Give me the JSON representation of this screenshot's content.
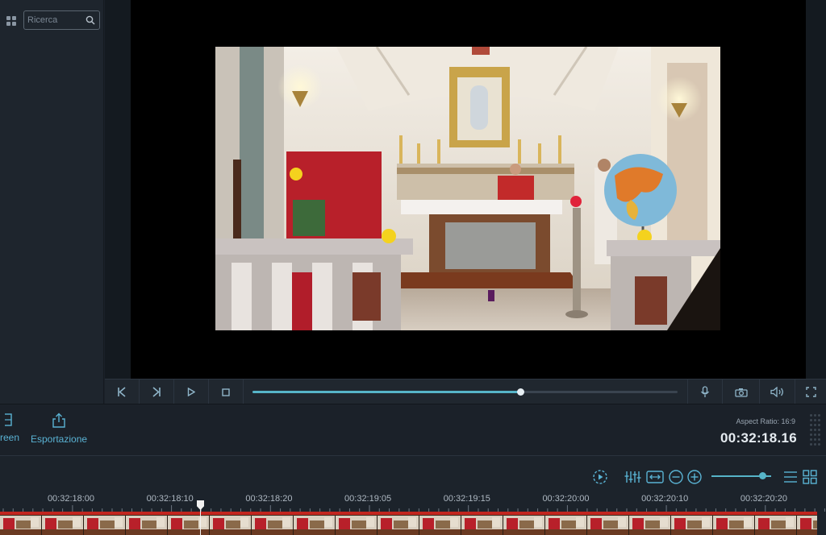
{
  "library": {
    "search": {
      "placeholder": "Ricerca",
      "value": ""
    }
  },
  "player": {
    "progress": 0.63,
    "buttons": [
      "skip-back",
      "skip-forward",
      "play",
      "stop"
    ],
    "right_buttons": [
      "microphone",
      "camera",
      "volume",
      "fullscreen"
    ]
  },
  "toolbar": {
    "screen_label": "creen",
    "export_label": "Esportazione",
    "aspect_ratio": "Aspect Ratio: 16:9",
    "timecode": "00:32:18.16"
  },
  "timeline": {
    "ruler": [
      "00:32:18:00",
      "00:32:18:10",
      "00:32:18:20",
      "00:32:19:05",
      "00:32:19:15",
      "00:32:20:00",
      "00:32:20:10",
      "00:32:20:20"
    ],
    "zoom_level": 0.85,
    "clip_color": "#c2261f"
  },
  "colors": {
    "accent": "#56b4c8",
    "label_blue": "#5ab3d4"
  }
}
